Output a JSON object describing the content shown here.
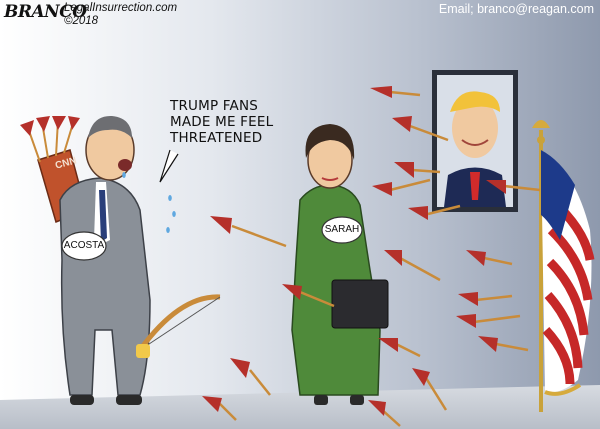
{
  "signature": {
    "artist": "BRANCO",
    "site": "LegalInsurrection.com",
    "copyright": "©2018"
  },
  "contact": {
    "email": "Email; branco@reagan.com"
  },
  "speech_bubble": {
    "lines": [
      "TRUMP FANS",
      "MADE ME FEEL",
      "THREATENED"
    ]
  },
  "labels": {
    "quiver": "CNN",
    "acosta_badge": "ACOSTA",
    "sarah_badge": "SARAH"
  },
  "colors": {
    "wall": "#aeb6c6",
    "floor": "#c9cdd4",
    "dress": "#4f8a3a",
    "suit": "#8a9098",
    "quiver": "#c0522c",
    "arrow_shaft": "#c98b3a",
    "fletching": "#b5302a"
  }
}
